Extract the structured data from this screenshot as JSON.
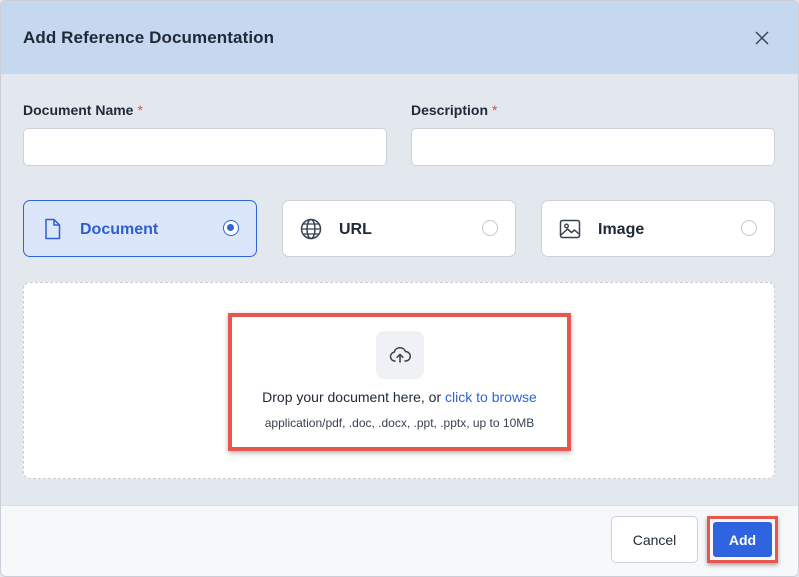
{
  "dialog": {
    "title": "Add Reference Documentation"
  },
  "form": {
    "name_label": "Document Name",
    "name_required": "*",
    "name_value": "",
    "description_label": "Description",
    "description_required": "*",
    "description_value": ""
  },
  "types": [
    {
      "label": "Document",
      "icon": "file-icon",
      "selected": true
    },
    {
      "label": "URL",
      "icon": "globe-icon",
      "selected": false
    },
    {
      "label": "Image",
      "icon": "image-icon",
      "selected": false
    }
  ],
  "upload": {
    "icon": "cloud-upload-icon",
    "drop_text": "Drop your document here, or",
    "browse_text": "click to browse",
    "hint": "application/pdf, .doc, .docx, .ppt, .pptx, up to 10MB"
  },
  "footer": {
    "cancel_label": "Cancel",
    "add_label": "Add"
  },
  "colors": {
    "accent": "#2f64e0",
    "header_bg": "#c6d7f0",
    "required": "#e5484d",
    "highlight": "#e8574f"
  }
}
